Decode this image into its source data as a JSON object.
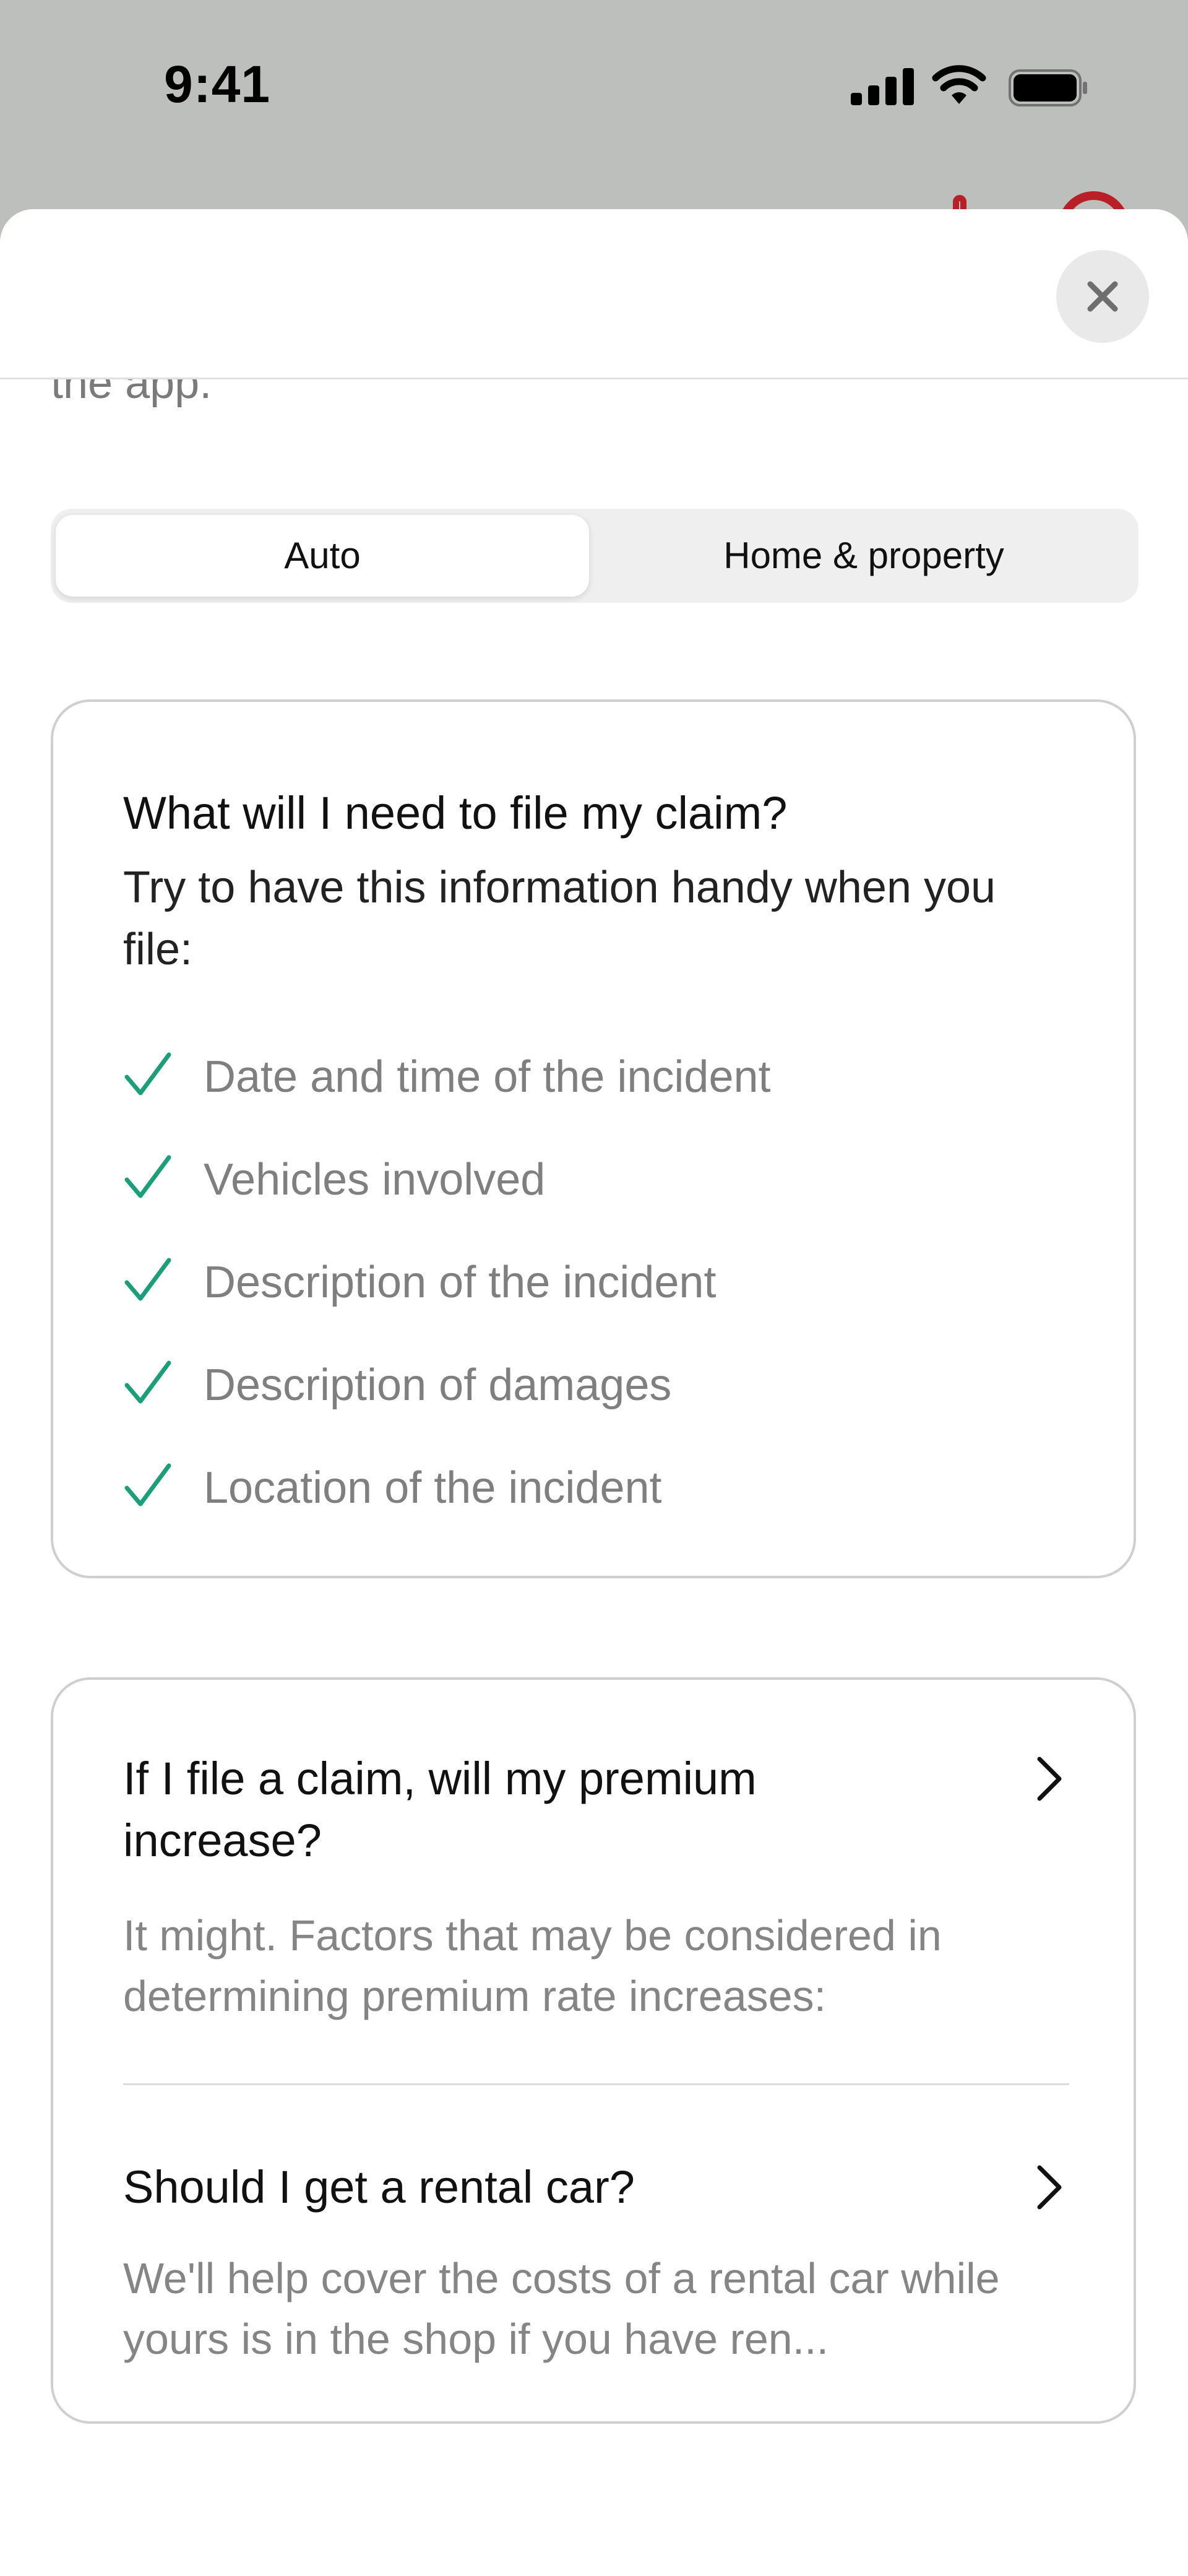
{
  "status_bar": {
    "time": "9:41"
  },
  "header": {
    "clipped_text": "the app."
  },
  "segmented_control": {
    "options": [
      "Auto",
      "Home & property"
    ],
    "selected": "Auto"
  },
  "checklist_card": {
    "title": "What will I need to file my claim?",
    "intro": "Try to have this information handy when you file:",
    "items": [
      "Date and time of the incident",
      "Vehicles involved",
      "Description of the incident",
      "Description of damages",
      "Location of the incident"
    ],
    "check_color": "#1a9f7a"
  },
  "faq_card": {
    "items": [
      {
        "question": "If I file a claim, will my premium increase?",
        "answer": "It might. Factors that may be considered in determining premium rate increases:"
      },
      {
        "question": "Should I get a rental car?",
        "answer": "We'll help cover the costs of a rental car while yours is in the shop if you have ren..."
      }
    ]
  }
}
